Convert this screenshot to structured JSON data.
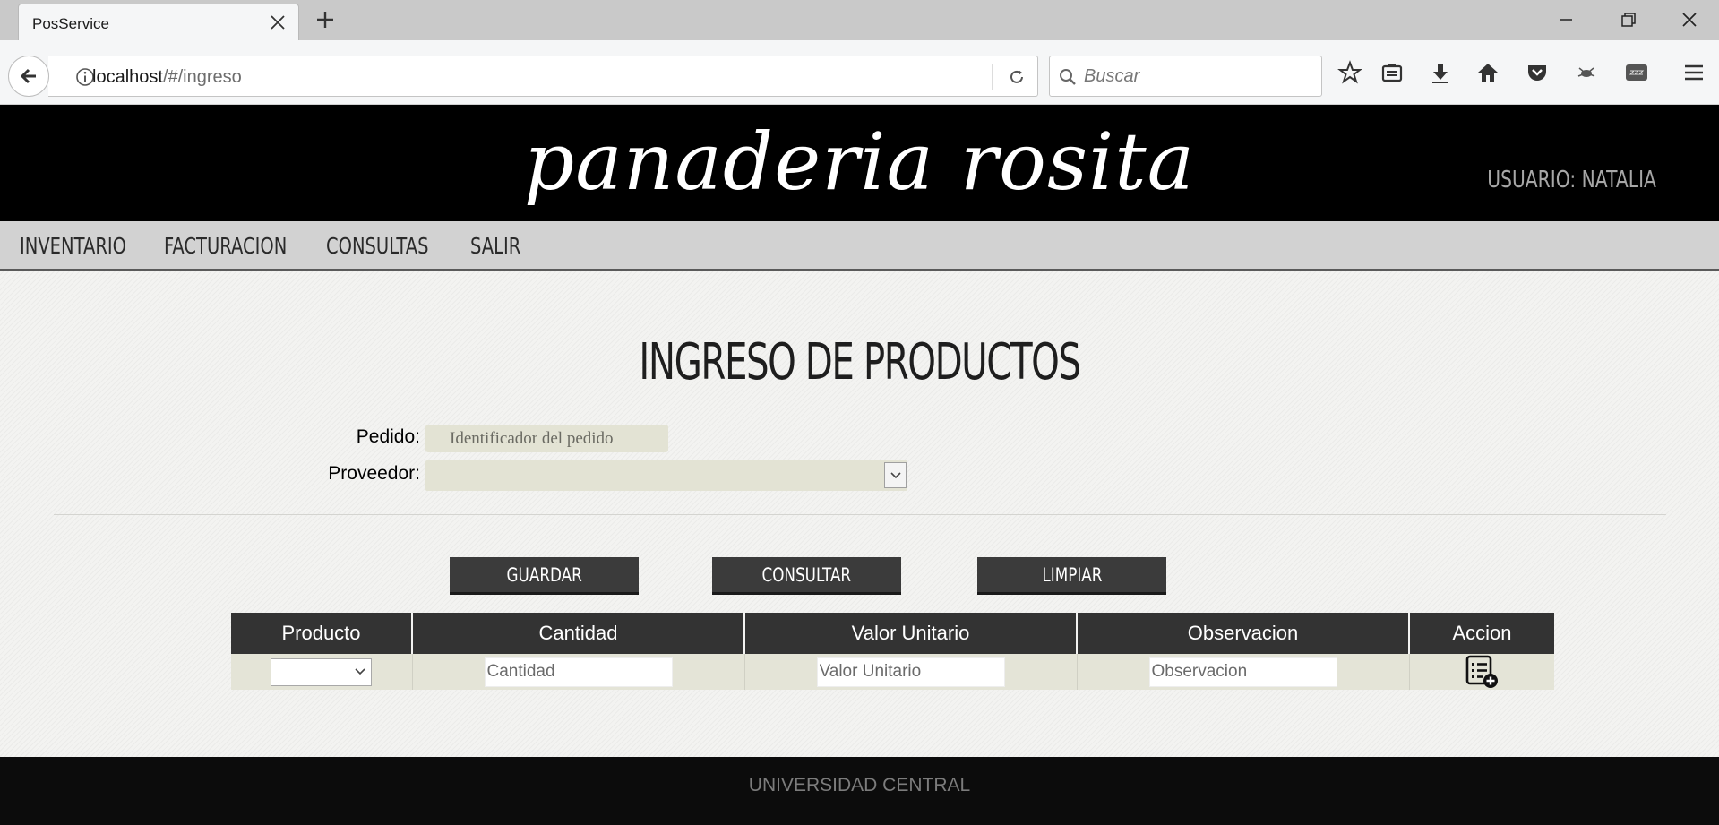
{
  "browser": {
    "tab_title": "PosService",
    "url_host": "localhost",
    "url_path": "/#/ingreso",
    "search_placeholder": "Buscar"
  },
  "header": {
    "logo": "panaderia rosita",
    "user_label": "USUARIO: NATALIA"
  },
  "nav": {
    "items": [
      "INVENTARIO",
      "FACTURACION",
      "CONSULTAS",
      "SALIR"
    ]
  },
  "form": {
    "title": "INGRESO DE PRODUCTOS",
    "pedido_label": "Pedido:",
    "pedido_placeholder": "Identificador del pedido",
    "proveedor_label": "Proveedor:"
  },
  "buttons": {
    "guardar": "GUARDAR",
    "consultar": "CONSULTAR",
    "limpiar": "LIMPIAR"
  },
  "table": {
    "headers": [
      "Producto",
      "Cantidad",
      "Valor Unitario",
      "Observacion",
      "Accion"
    ],
    "placeholders": {
      "cantidad": "Cantidad",
      "valor_unitario": "Valor Unitario",
      "observacion": "Observacion"
    }
  },
  "footer": {
    "text": "UNIVERSIDAD CENTRAL"
  }
}
